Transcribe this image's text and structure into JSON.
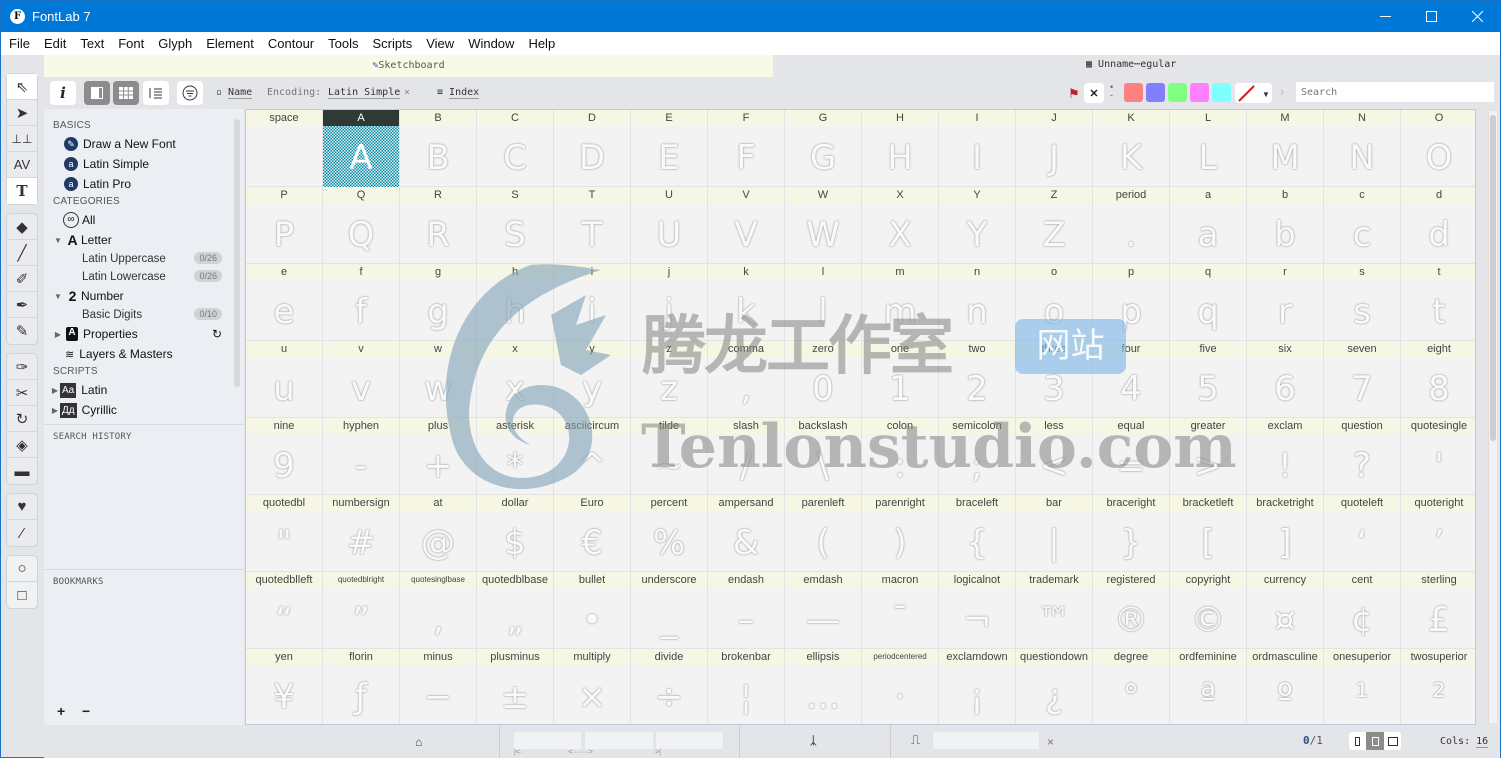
{
  "window": {
    "title": "FontLab 7",
    "app_icon": "F"
  },
  "menu": [
    "File",
    "Edit",
    "Text",
    "Font",
    "Glyph",
    "Element",
    "Contour",
    "Tools",
    "Scripts",
    "View",
    "Window",
    "Help"
  ],
  "sketchboard": {
    "label": "Sketchboard"
  },
  "font_tab": {
    "label": "Unname⋯egular"
  },
  "toolbar": {
    "name_label": "Name",
    "encoding_label": "Encoding:",
    "encoding_value": "Latin Simple",
    "index_label": "Index",
    "search_placeholder": "Search",
    "flag_colors": [
      "#ff8080",
      "#8080ff",
      "#80ff80",
      "#ff80ff",
      "#80ffff"
    ]
  },
  "sidebar": {
    "basics_title": "BASICS",
    "basics": [
      {
        "label": "Draw a New Font",
        "icon": "✎"
      },
      {
        "label": "Latin Simple",
        "icon": "a"
      },
      {
        "label": "Latin Pro",
        "icon": "a"
      }
    ],
    "categories_title": "CATEGORIES",
    "all_label": "All",
    "letter_label": "Letter",
    "latin_uppercase": {
      "label": "Latin Uppercase",
      "count": "0/26"
    },
    "latin_lowercase": {
      "label": "Latin Lowercase",
      "count": "0/26"
    },
    "number_label": "Number",
    "basic_digits": {
      "label": "Basic Digits",
      "count": "0/10"
    },
    "properties_label": "Properties",
    "layers_label": "Layers & Masters",
    "scripts_title": "SCRIPTS",
    "scripts": [
      {
        "label": "Latin",
        "icon": "Aa"
      },
      {
        "label": "Cyrillic",
        "icon": "Дд"
      }
    ],
    "search_history_title": "SEARCH HISTORY",
    "bookmarks_title": "BOOKMARKS",
    "add": "+",
    "remove": "−"
  },
  "glyphs": [
    [
      "space",
      " "
    ],
    [
      "A",
      "A"
    ],
    [
      "B",
      "B"
    ],
    [
      "C",
      "C"
    ],
    [
      "D",
      "D"
    ],
    [
      "E",
      "E"
    ],
    [
      "F",
      "F"
    ],
    [
      "G",
      "G"
    ],
    [
      "H",
      "H"
    ],
    [
      "I",
      "I"
    ],
    [
      "J",
      "J"
    ],
    [
      "K",
      "K"
    ],
    [
      "L",
      "L"
    ],
    [
      "M",
      "M"
    ],
    [
      "N",
      "N"
    ],
    [
      "O",
      "O"
    ],
    [
      "P",
      "P"
    ],
    [
      "Q",
      "Q"
    ],
    [
      "R",
      "R"
    ],
    [
      "S",
      "S"
    ],
    [
      "T",
      "T"
    ],
    [
      "U",
      "U"
    ],
    [
      "V",
      "V"
    ],
    [
      "W",
      "W"
    ],
    [
      "X",
      "X"
    ],
    [
      "Y",
      "Y"
    ],
    [
      "Z",
      "Z"
    ],
    [
      "period",
      "."
    ],
    [
      "a",
      "a"
    ],
    [
      "b",
      "b"
    ],
    [
      "c",
      "c"
    ],
    [
      "d",
      "d"
    ],
    [
      "e",
      "e"
    ],
    [
      "f",
      "f"
    ],
    [
      "g",
      "g"
    ],
    [
      "h",
      "h"
    ],
    [
      "i",
      "i"
    ],
    [
      "j",
      "j"
    ],
    [
      "k",
      "k"
    ],
    [
      "l",
      "l"
    ],
    [
      "m",
      "m"
    ],
    [
      "n",
      "n"
    ],
    [
      "o",
      "o"
    ],
    [
      "p",
      "p"
    ],
    [
      "q",
      "q"
    ],
    [
      "r",
      "r"
    ],
    [
      "s",
      "s"
    ],
    [
      "t",
      "t"
    ],
    [
      "u",
      "u"
    ],
    [
      "v",
      "v"
    ],
    [
      "w",
      "w"
    ],
    [
      "x",
      "x"
    ],
    [
      "y",
      "y"
    ],
    [
      "z",
      "z"
    ],
    [
      "comma",
      ","
    ],
    [
      "zero",
      "0"
    ],
    [
      "one",
      "1"
    ],
    [
      "two",
      "2"
    ],
    [
      "three",
      "3"
    ],
    [
      "four",
      "4"
    ],
    [
      "five",
      "5"
    ],
    [
      "six",
      "6"
    ],
    [
      "seven",
      "7"
    ],
    [
      "eight",
      "8"
    ],
    [
      "nine",
      "9"
    ],
    [
      "hyphen",
      "-"
    ],
    [
      "plus",
      "+"
    ],
    [
      "asterisk",
      "*"
    ],
    [
      "asciicircum",
      "^"
    ],
    [
      "tilde",
      "~"
    ],
    [
      "slash",
      "/"
    ],
    [
      "backslash",
      "\\"
    ],
    [
      "colon",
      ":"
    ],
    [
      "semicolon",
      ";"
    ],
    [
      "less",
      "<"
    ],
    [
      "equal",
      "="
    ],
    [
      "greater",
      ">"
    ],
    [
      "exclam",
      "!"
    ],
    [
      "question",
      "?"
    ],
    [
      "quotesingle",
      "'"
    ],
    [
      "quotedbl",
      "\""
    ],
    [
      "numbersign",
      "#"
    ],
    [
      "at",
      "@"
    ],
    [
      "dollar",
      "$"
    ],
    [
      "Euro",
      "€"
    ],
    [
      "percent",
      "%"
    ],
    [
      "ampersand",
      "&"
    ],
    [
      "parenleft",
      "("
    ],
    [
      "parenright",
      ")"
    ],
    [
      "braceleft",
      "{"
    ],
    [
      "bar",
      "|"
    ],
    [
      "braceright",
      "}"
    ],
    [
      "bracketleft",
      "["
    ],
    [
      "bracketright",
      "]"
    ],
    [
      "quoteleft",
      "‘"
    ],
    [
      "quoteright",
      "’"
    ],
    [
      "quotedblleft",
      "“"
    ],
    [
      "quotedblright",
      "”"
    ],
    [
      "quotesinglbase",
      "‚"
    ],
    [
      "quotedblbase",
      "„"
    ],
    [
      "bullet",
      "•"
    ],
    [
      "underscore",
      "_"
    ],
    [
      "endash",
      "–"
    ],
    [
      "emdash",
      "—"
    ],
    [
      "macron",
      "¯"
    ],
    [
      "logicalnot",
      "¬"
    ],
    [
      "trademark",
      "™"
    ],
    [
      "registered",
      "®"
    ],
    [
      "copyright",
      "©"
    ],
    [
      "currency",
      "¤"
    ],
    [
      "cent",
      "¢"
    ],
    [
      "sterling",
      "£"
    ],
    [
      "yen",
      "¥"
    ],
    [
      "florin",
      "ƒ"
    ],
    [
      "minus",
      "−"
    ],
    [
      "plusminus",
      "±"
    ],
    [
      "multiply",
      "×"
    ],
    [
      "divide",
      "÷"
    ],
    [
      "brokenbar",
      "¦"
    ],
    [
      "ellipsis",
      "…"
    ],
    [
      "periodcentered",
      "·"
    ],
    [
      "exclamdown",
      "¡"
    ],
    [
      "questiondown",
      "¿"
    ],
    [
      "degree",
      "°"
    ],
    [
      "ordfeminine",
      "ª"
    ],
    [
      "ordmasculine",
      "º"
    ],
    [
      "onesuperior",
      "¹"
    ],
    [
      "twosuperior",
      "²"
    ]
  ],
  "selected_glyph": "A",
  "watermark": {
    "cn_text": "腾龙工作室",
    "badge": "网站",
    "url": "Tenlonstudio.com"
  },
  "statusbar": {
    "page_current": "0",
    "page_total": "/1",
    "cols_label": "Cols:",
    "cols_value": "16",
    "close": "×"
  }
}
